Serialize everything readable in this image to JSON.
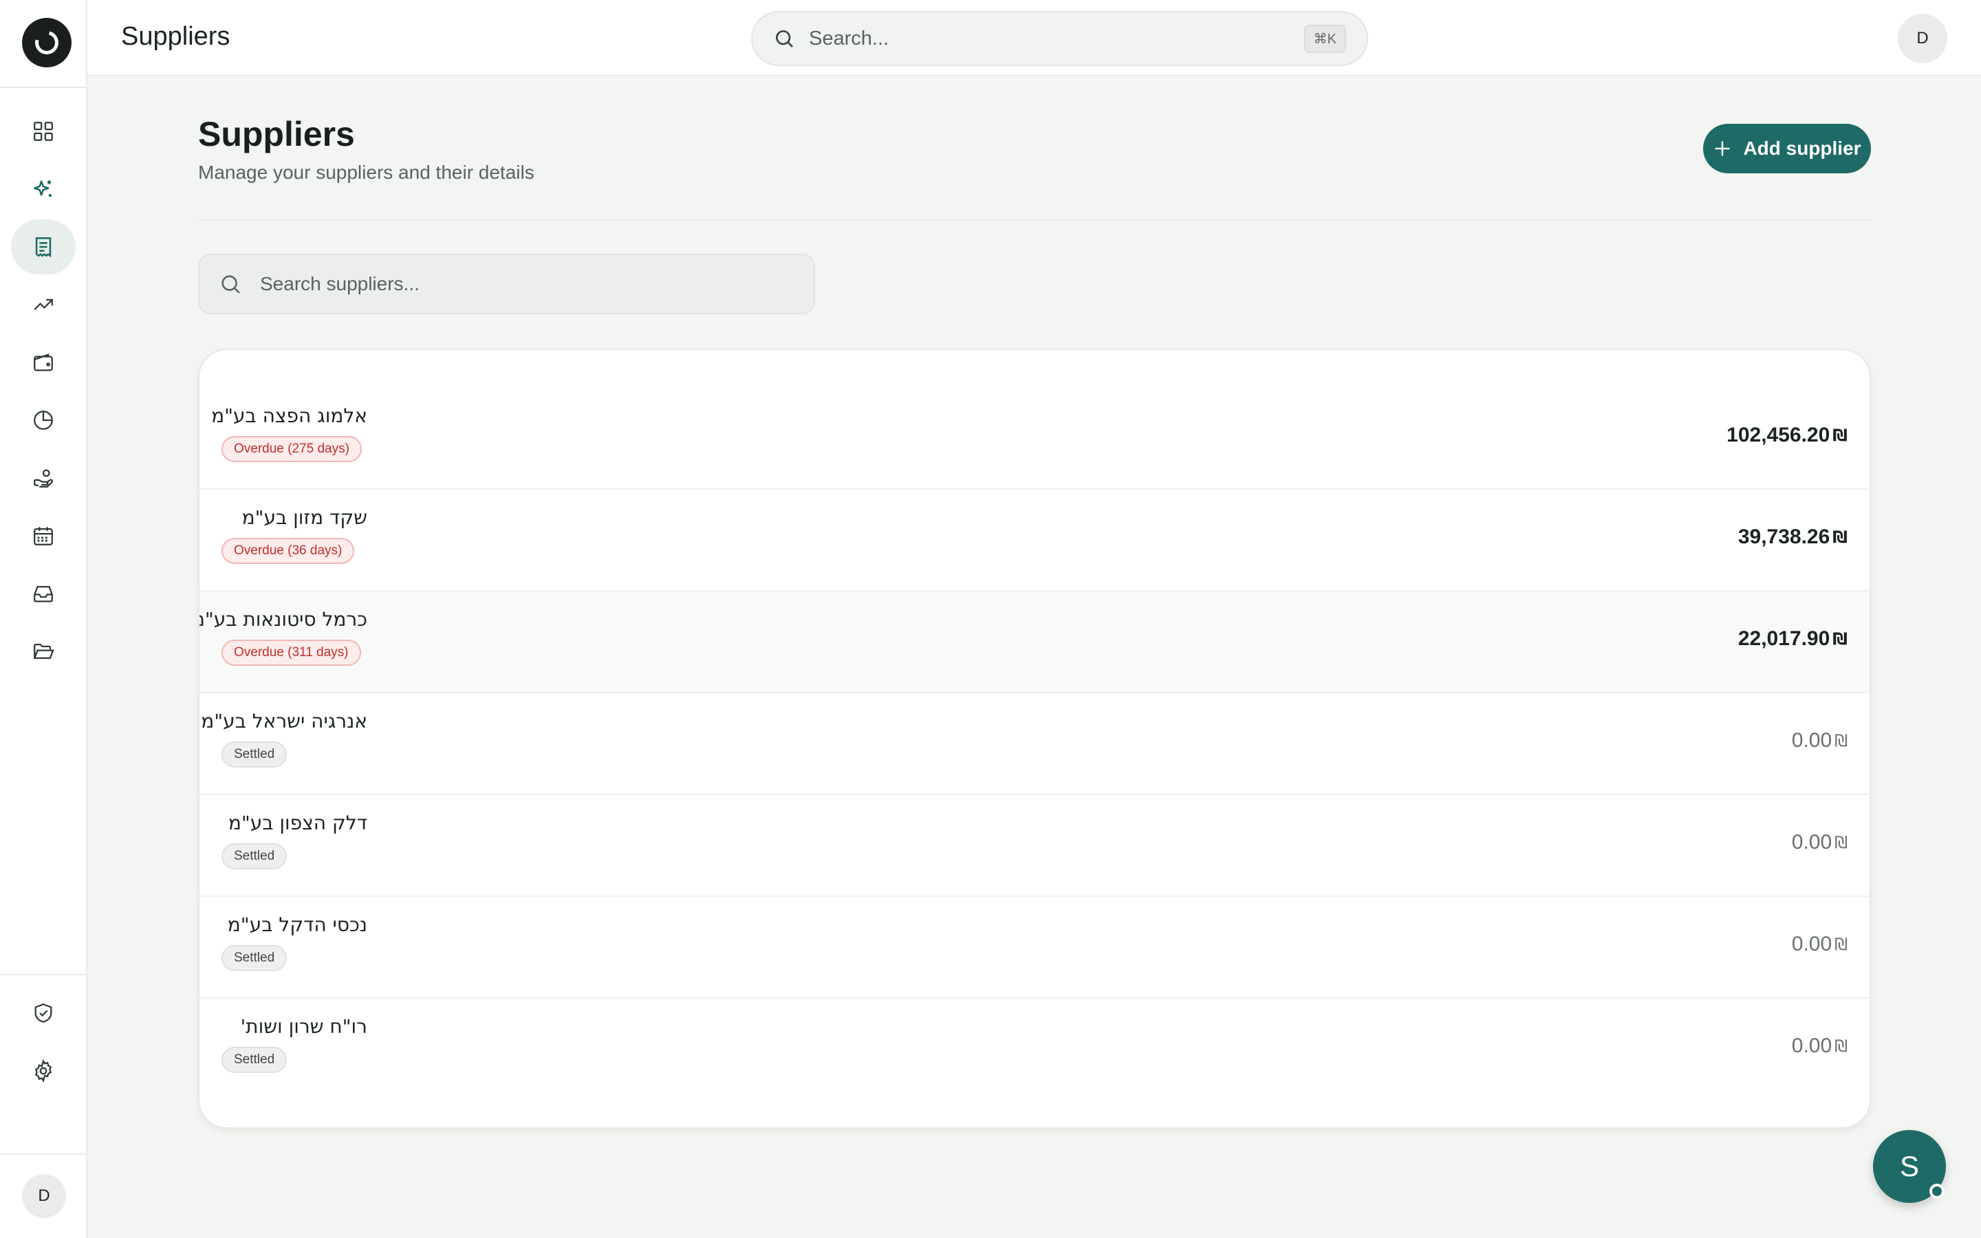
{
  "header": {
    "title": "Suppliers",
    "search_placeholder": "Search...",
    "shortcut": "⌘K",
    "avatar_initial": "D"
  },
  "sidebar": {
    "items": [
      {
        "name": "dashboard",
        "icon": "grid-icon",
        "active": false
      },
      {
        "name": "ai",
        "icon": "sparkles-icon",
        "active": false
      },
      {
        "name": "invoices",
        "icon": "receipt-icon",
        "active": true
      },
      {
        "name": "trends",
        "icon": "trending-up-icon",
        "active": false
      },
      {
        "name": "wallet",
        "icon": "wallet-icon",
        "active": false
      },
      {
        "name": "reports",
        "icon": "pie-chart-icon",
        "active": false
      },
      {
        "name": "payments",
        "icon": "hand-coins-icon",
        "active": false
      },
      {
        "name": "calendar",
        "icon": "calendar-icon",
        "active": false
      },
      {
        "name": "inbox",
        "icon": "inbox-icon",
        "active": false
      },
      {
        "name": "files",
        "icon": "folder-open-icon",
        "active": false
      }
    ],
    "bottom_items": [
      {
        "name": "security",
        "icon": "shield-check-icon"
      },
      {
        "name": "settings",
        "icon": "gear-icon"
      }
    ],
    "avatar_initial": "D"
  },
  "page": {
    "title": "Suppliers",
    "subtitle": "Manage your suppliers and their details",
    "add_button": "Add supplier",
    "search_placeholder": "Search suppliers..."
  },
  "suppliers": [
    {
      "name": "אלמוג הפצה בע\"מ",
      "status": "Overdue (275 days)",
      "status_type": "overdue",
      "amount": "102,456.20",
      "currency": "₪"
    },
    {
      "name": "שקד מזון בע\"מ",
      "status": "Overdue (36 days)",
      "status_type": "overdue",
      "amount": "39,738.26",
      "currency": "₪"
    },
    {
      "name": "כרמל סיטונאות בע\"מ",
      "status": "Overdue (311 days)",
      "status_type": "overdue",
      "amount": "22,017.90",
      "currency": "₪"
    },
    {
      "name": "אנרגיה ישראל בע\"מ",
      "status": "Settled",
      "status_type": "settled",
      "amount": "0.00",
      "currency": "₪"
    },
    {
      "name": "דלק הצפון בע\"מ",
      "status": "Settled",
      "status_type": "settled",
      "amount": "0.00",
      "currency": "₪"
    },
    {
      "name": "נכסי הדקל בע\"מ",
      "status": "Settled",
      "status_type": "settled",
      "amount": "0.00",
      "currency": "₪"
    },
    {
      "name": "רו\"ח שרון ושות'",
      "status": "Settled",
      "status_type": "settled",
      "amount": "0.00",
      "currency": "₪"
    }
  ],
  "fab": {
    "label": "S"
  },
  "colors": {
    "accent": "#1e6a66",
    "overdue": "#c0302a",
    "background": "#f3f5f2"
  }
}
